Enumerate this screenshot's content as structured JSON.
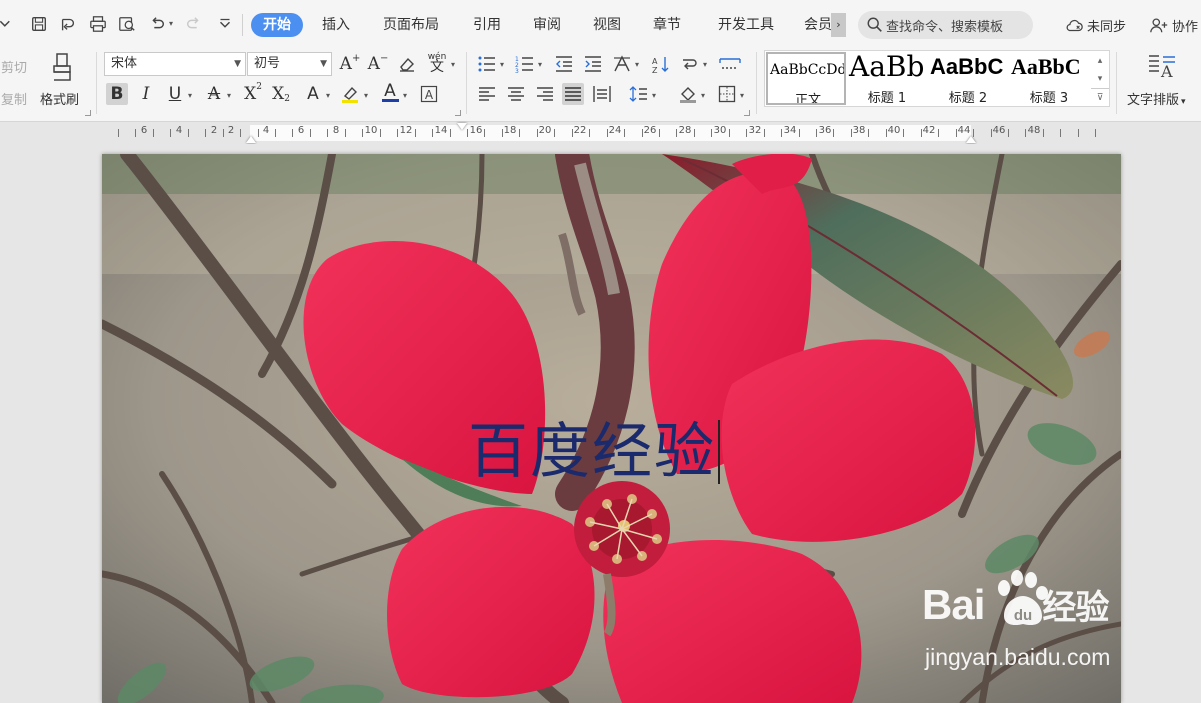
{
  "tabs": {
    "items": [
      {
        "label": "开始",
        "active": true
      },
      {
        "label": "插入"
      },
      {
        "label": "页面布局"
      },
      {
        "label": "引用"
      },
      {
        "label": "审阅"
      },
      {
        "label": "视图"
      },
      {
        "label": "章节"
      },
      {
        "label": "开发工具"
      },
      {
        "label": "会员"
      }
    ],
    "search_placeholder": "查找命令、搜索模板",
    "sync_status": "未同步",
    "collab_label": "协作"
  },
  "quick_access": {
    "icons": [
      "menu-arrow-icon",
      "save-icon",
      "export-icon",
      "print-icon",
      "print-preview-icon",
      "undo-icon",
      "redo-icon",
      "customize-icon"
    ]
  },
  "clipboard": {
    "cut_label": "剪切",
    "copy_label": "复制",
    "format_painter_label": "格式刷"
  },
  "font": {
    "family": "宋体",
    "size": "初号",
    "pinyin_label": "wén",
    "pinyin_char": "文"
  },
  "styles": {
    "items": [
      {
        "preview": "AaBbCcDd",
        "label": "正文",
        "selected": true
      },
      {
        "preview": "AaBb",
        "label": "标题 1"
      },
      {
        "preview": "AaBbC",
        "label": "标题 2"
      },
      {
        "preview": "AaBbC",
        "label": "标题 3"
      }
    ]
  },
  "text_layout_label": "文字排版",
  "ruler": {
    "labels": [
      "6",
      "4",
      "2",
      "2",
      "4",
      "6",
      "8",
      "10",
      "12",
      "14",
      "16",
      "18",
      "20",
      "22",
      "24",
      "26",
      "28",
      "30",
      "32",
      "34",
      "36",
      "38",
      "40",
      "42",
      "44",
      "46",
      "48"
    ]
  },
  "document": {
    "text": "百度经验"
  },
  "watermark": {
    "name": "Bai",
    "name_suffix": "经验",
    "url": "jingyan.baidu.com"
  },
  "colors": {
    "active_tab": "#4b8ff0",
    "doc_text": "#1a2a6c",
    "font_color_red": "#e02020",
    "font_color_blue": "#1f3fa8"
  }
}
